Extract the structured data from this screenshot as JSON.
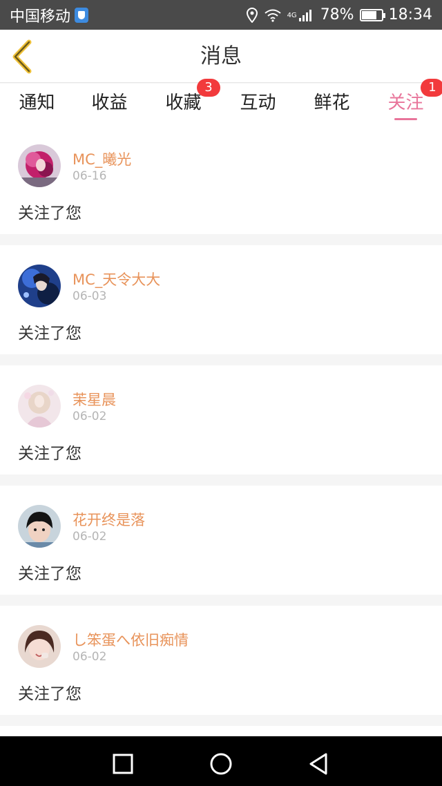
{
  "status_bar": {
    "carrier": "中国移动",
    "network": "4G",
    "battery": "78%",
    "battery_level": 0.78,
    "time": "18:34"
  },
  "header": {
    "title": "消息"
  },
  "tabs": [
    {
      "label": "通知",
      "badge": ""
    },
    {
      "label": "收益",
      "badge": ""
    },
    {
      "label": "收藏",
      "badge": "3"
    },
    {
      "label": "互动",
      "badge": ""
    },
    {
      "label": "鲜花",
      "badge": ""
    },
    {
      "label": "关注",
      "badge": "1",
      "active": true
    }
  ],
  "messages": [
    {
      "name": "MC_曦光",
      "date": "06-16",
      "text": "关注了您"
    },
    {
      "name": "MC_天令大大",
      "date": "06-03",
      "text": "关注了您"
    },
    {
      "name": "茉星晨",
      "date": "06-02",
      "text": "关注了您"
    },
    {
      "name": "花开终是落",
      "date": "06-02",
      "text": "关注了您"
    },
    {
      "name": "し笨蛋へ依旧痴情",
      "date": "06-02",
      "text": "关注了您"
    }
  ],
  "colors": {
    "accent": "#e8749a",
    "name": "#e8935a",
    "badge": "#f23a3c"
  }
}
